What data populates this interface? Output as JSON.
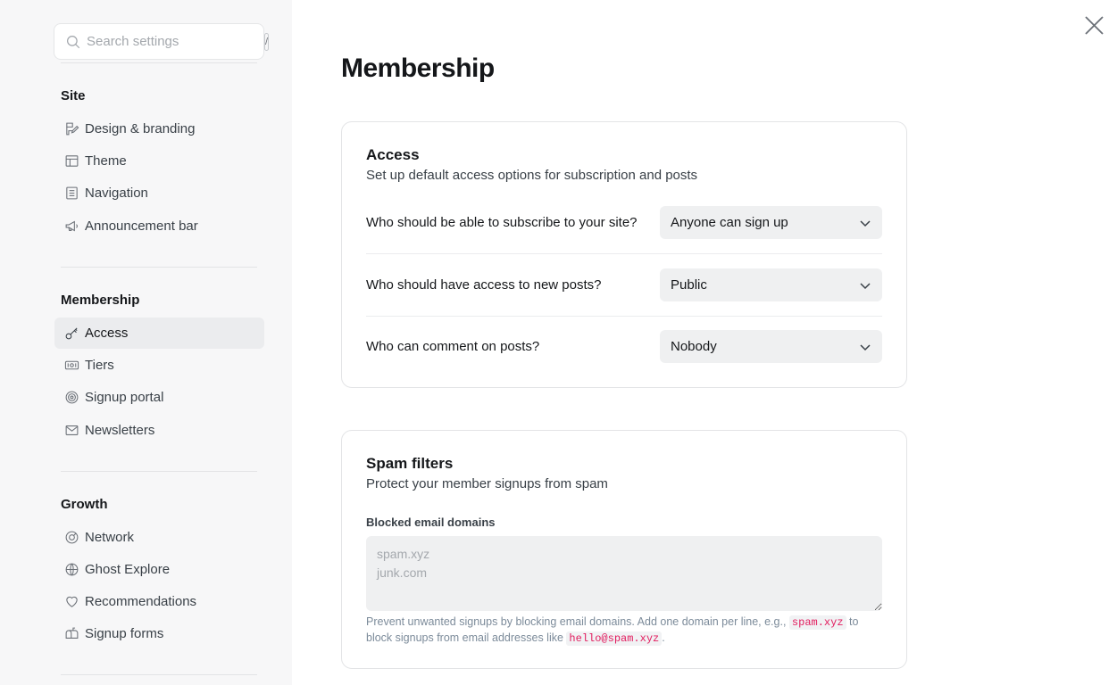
{
  "search": {
    "placeholder": "Search settings",
    "shortcut": "/"
  },
  "sidebar": {
    "sections": [
      {
        "title": "Site",
        "items": [
          {
            "label": "Design & branding",
            "icon": "paintbrush-icon"
          },
          {
            "label": "Theme",
            "icon": "layout-icon"
          },
          {
            "label": "Navigation",
            "icon": "list-icon"
          },
          {
            "label": "Announcement bar",
            "icon": "megaphone-icon"
          }
        ]
      },
      {
        "title": "Membership",
        "items": [
          {
            "label": "Access",
            "icon": "key-icon",
            "active": true
          },
          {
            "label": "Tiers",
            "icon": "ticket-icon"
          },
          {
            "label": "Signup portal",
            "icon": "portal-icon"
          },
          {
            "label": "Newsletters",
            "icon": "mail-icon"
          }
        ]
      },
      {
        "title": "Growth",
        "items": [
          {
            "label": "Network",
            "icon": "network-icon"
          },
          {
            "label": "Ghost Explore",
            "icon": "globe-icon"
          },
          {
            "label": "Recommendations",
            "icon": "heart-icon"
          },
          {
            "label": "Signup forms",
            "icon": "mailbox-icon"
          }
        ]
      }
    ]
  },
  "main": {
    "title": "Membership",
    "access": {
      "title": "Access",
      "description": "Set up default access options for subscription and posts",
      "rows": [
        {
          "label": "Who should be able to subscribe to your site?",
          "value": "Anyone can sign up"
        },
        {
          "label": "Who should have access to new posts?",
          "value": "Public"
        },
        {
          "label": "Who can comment on posts?",
          "value": "Nobody"
        }
      ]
    },
    "spam": {
      "title": "Spam filters",
      "description": "Protect your member signups from spam",
      "field_label": "Blocked email domains",
      "placeholder": "spam.xyz\njunk.com",
      "hint_part1": "Prevent unwanted signups by blocking email domains. Add one domain per line, e.g.,",
      "hint_code1": "spam.xyz",
      "hint_part2": "to block signups from email addresses like",
      "hint_code2": "hello@spam.xyz",
      "hint_part3": "."
    }
  },
  "colors": {
    "accent": "#15171a",
    "code": "#e21c5e",
    "sidebar_bg": "#f7f7f8"
  }
}
